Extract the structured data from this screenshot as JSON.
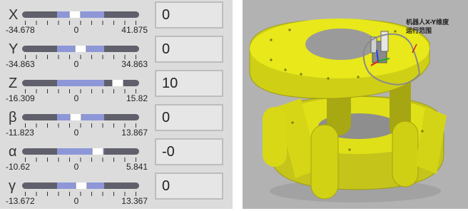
{
  "sliders": [
    {
      "label": "X",
      "min_label": "-34.678",
      "zero_label": "0",
      "max_label": "41.875",
      "min": -34.678,
      "max": 41.875,
      "value": 0,
      "value_text": "0"
    },
    {
      "label": "Y",
      "min_label": "-34.863",
      "zero_label": "0",
      "max_label": "34.863",
      "min": -34.863,
      "max": 34.863,
      "value": 0,
      "value_text": "0"
    },
    {
      "label": "Z",
      "min_label": "-16.309",
      "zero_label": "0",
      "max_label": "15.82",
      "min": -16.309,
      "max": 15.82,
      "value": 10,
      "value_text": "10"
    },
    {
      "label": "β",
      "min_label": "-11.823",
      "zero_label": "0",
      "max_label": "13.867",
      "min": -11.823,
      "max": 13.867,
      "value": 0,
      "value_text": "0"
    },
    {
      "label": "α",
      "min_label": "-10.62",
      "zero_label": "0",
      "max_label": "5.841",
      "min": -10.62,
      "max": 5.841,
      "value": 0,
      "value_text": "-0"
    },
    {
      "label": "γ",
      "min_label": "-13.672",
      "zero_label": "0",
      "max_label": "13.367",
      "min": -13.672,
      "max": 13.367,
      "value": 0,
      "value_text": "0"
    }
  ],
  "colors": {
    "panel_bg": "#dcdcdc",
    "slider_track": "#60606c",
    "slider_fill": "#8d97d8",
    "value_box_bg": "#e6e6e6",
    "model_yellow": "#e6e612",
    "viewport_bg": "#b2b2b2"
  },
  "viewport": {
    "annotation_line1": "机器人X-Y维度",
    "annotation_line2": "运行范围"
  }
}
